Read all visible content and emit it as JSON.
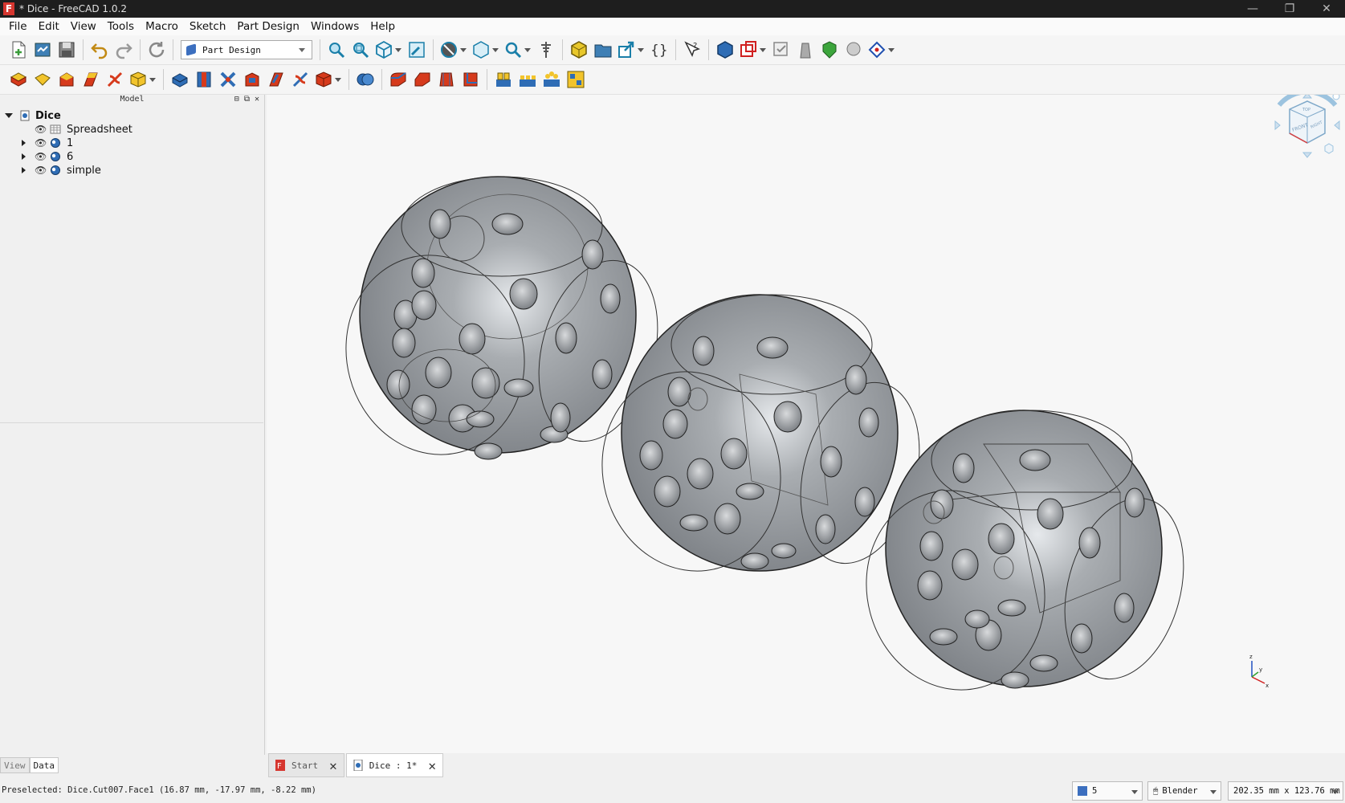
{
  "window": {
    "title": "* Dice - FreeCAD 1.0.2",
    "app_icon_letter": "F",
    "minimize": "—",
    "maximize": "❐",
    "close": "✕"
  },
  "menu": [
    "File",
    "Edit",
    "View",
    "Tools",
    "Macro",
    "Sketch",
    "Part Design",
    "Windows",
    "Help"
  ],
  "toolbar": {
    "workbench_label": "Part Design"
  },
  "model_panel": {
    "title": "Model",
    "tree": [
      {
        "label": "Dice",
        "level": 0,
        "expanded": true
      },
      {
        "label": "Spreadsheet",
        "level": 1,
        "expanded": false
      },
      {
        "label": "1",
        "level": 1,
        "expanded": false
      },
      {
        "label": "6",
        "level": 1,
        "expanded": false
      },
      {
        "label": "simple",
        "level": 1,
        "expanded": false
      }
    ],
    "tabs": {
      "view": "View",
      "data": "Data"
    }
  },
  "navcube": {
    "face_front": "FRONT",
    "face_top": "TOP",
    "face_right": "RIGHT"
  },
  "axis": {
    "x": "x",
    "y": "y",
    "z": "z"
  },
  "doc_tabs": [
    {
      "label": "Start",
      "active": false
    },
    {
      "label": "Dice : 1*",
      "active": true
    }
  ],
  "status": {
    "message": "Preselected: Dice.Cut007.Face1 (16.87 mm, -17.97 mm, -8.22 mm)",
    "draw_style": "5",
    "nav_style": "Blender",
    "dimensions": "202.35 mm x 123.76 mm"
  },
  "colors": {
    "titlebar": "#1e1e1e",
    "dice_fill": "#8e9398",
    "viewport_bg": "#f7f7f7"
  }
}
